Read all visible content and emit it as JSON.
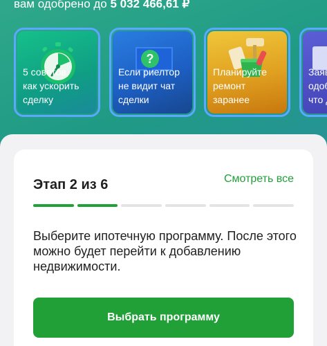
{
  "header": {
    "approved_prefix": "вам одобрено до ",
    "approved_amount": "5 032 466,61 ₽"
  },
  "stories": [
    {
      "label": "5 советов,\nкак ускорить\nсделку",
      "icon": "stopwatch-icon"
    },
    {
      "label": "Если риелтор\nне видит чат\nсделки",
      "icon": "question-chat-icon"
    },
    {
      "label": "Планируйте\nремонт\nзаранее",
      "icon": "paint-roller-icon"
    },
    {
      "label": "Заяв\nодоб\nчто д",
      "icon": "document-icon"
    }
  ],
  "stage": {
    "title": "Этап 2 из 6",
    "see_all": "Смотреть все",
    "current": 2,
    "total": 6,
    "description": "Выберите ипотечную программу. После этого можно будет перейти к добавлению недвижимости.",
    "cta": "Выбрать программу"
  },
  "colors": {
    "accent": "#21a038",
    "story_border": "#5aa8ff"
  }
}
